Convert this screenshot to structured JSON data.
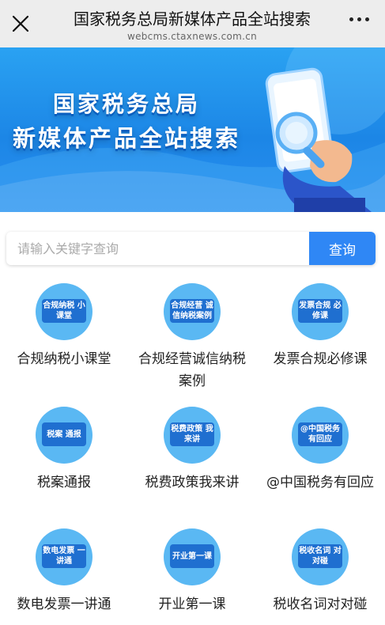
{
  "header": {
    "title": "国家税务总局新媒体产品全站搜索",
    "url": "webcms.ctaxnews.com.cn"
  },
  "banner": {
    "line1": "国家税务总局",
    "line2": "新媒体产品全站搜索"
  },
  "search": {
    "placeholder": "请输入关键字查询",
    "button": "查询"
  },
  "items": [
    {
      "label": "合规纳税小课堂",
      "icon_text": "合规纳税 小课堂"
    },
    {
      "label": "合规经营诚信纳税案例",
      "icon_text": "合规经营 诚信纳税案例"
    },
    {
      "label": "发票合规必修课",
      "icon_text": "发票合规 必修课"
    },
    {
      "label": "税案通报",
      "icon_text": "税案 通报"
    },
    {
      "label": "税费政策我来讲",
      "icon_text": "税费政策 我来讲"
    },
    {
      "label": "@中国税务有回应",
      "icon_text": "@中国税务 有回应"
    },
    {
      "label": "数电发票一讲通",
      "icon_text": "数电发票 一讲通"
    },
    {
      "label": "开业第一课",
      "icon_text": "开业第一课"
    },
    {
      "label": "税收名词对对碰",
      "icon_text": "税收名词 对对碰"
    }
  ]
}
